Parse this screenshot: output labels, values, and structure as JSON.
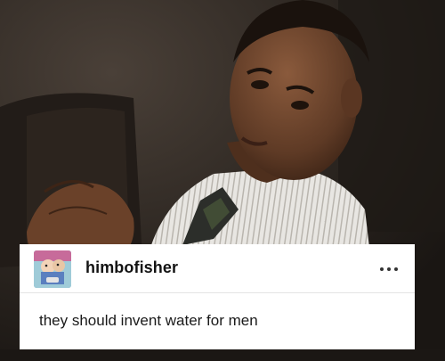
{
  "post": {
    "username": "himbofisher",
    "text": "they should invent water for men",
    "more_icon": "ellipsis-horizontal-icon",
    "avatar_icon": "avatar-icon"
  },
  "colors": {
    "card_bg": "#ffffff",
    "divider": "#e4e4e4",
    "text": "#1a1a1a"
  }
}
